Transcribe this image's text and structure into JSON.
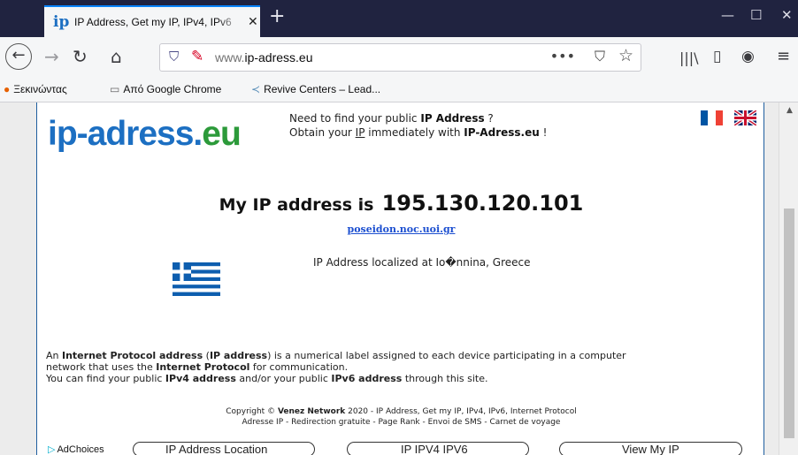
{
  "browser": {
    "tab": {
      "favicon": "ip",
      "title": "IP Address, Get my IP, IPv4, IPv6",
      "close": "✕"
    },
    "new_tab": "+",
    "window_controls": {
      "minimize": "—",
      "maximize": "☐",
      "close": "✕"
    },
    "address_bar": {
      "prefix": "www.",
      "domain": "ip-adress.eu",
      "more": "•••",
      "pocket_icon": "pocket-icon",
      "star_icon": "star-icon"
    },
    "bookmarks": [
      {
        "icon": "firefox-icon",
        "label": "Ξεκινώντας"
      },
      {
        "icon": "folder-icon",
        "label": "Από Google Chrome"
      },
      {
        "icon": "revive-icon",
        "label": "Revive Centers – Lead..."
      }
    ]
  },
  "page": {
    "logo": {
      "ip": "ip-adress.",
      "eu": "eu"
    },
    "tagline": {
      "line1_pre": "Need to find your public ",
      "line1_bold": "IP Address",
      "line1_post": " ?",
      "line2_pre": "Obtain your ",
      "line2_u": "IP",
      "line2_mid": " immediately with ",
      "line2_bold": "IP-Adress.eu",
      "line2_post": " !"
    },
    "my_ip_label": "My IP address is",
    "my_ip_value": "195.130.120.101",
    "hostname": "poseidon.noc.uoi.gr",
    "location": "IP Address localized at Io�nnina, Greece",
    "description": {
      "p1_a": "An ",
      "p1_b": "Internet Protocol address",
      "p1_c": " (",
      "p1_d": "IP address",
      "p1_e": ") is a numerical label assigned to each device participating in a computer",
      "p2_a": "network that uses the ",
      "p2_b": "Internet Protocol",
      "p2_c": " for communication.",
      "p3_a": "You can find your public ",
      "p3_b": "IPv4 address",
      "p3_c": " and/or your public ",
      "p3_d": "IPv6 address",
      "p3_e": " through this site."
    },
    "copyright": {
      "line1_a": "Copyright © ",
      "line1_b": "Venez Network",
      "line1_c": " 2020 - IP Address, Get my IP, IPv4, IPv6, Internet Protocol",
      "line2": "Adresse IP - Redirection gratuite - Page Rank - Envoi de SMS - Carnet de voyage"
    },
    "ad": {
      "adchoices": "AdChoices",
      "links": [
        "IP Address Location",
        "IP IPV4 IPV6",
        "View My IP"
      ]
    }
  },
  "colors": {
    "tabbar": "#202340",
    "logo_blue": "#1c6fc2",
    "logo_green": "#2c9a3a",
    "link": "#1c4fd0",
    "frame_border": "#1f5f9f"
  }
}
